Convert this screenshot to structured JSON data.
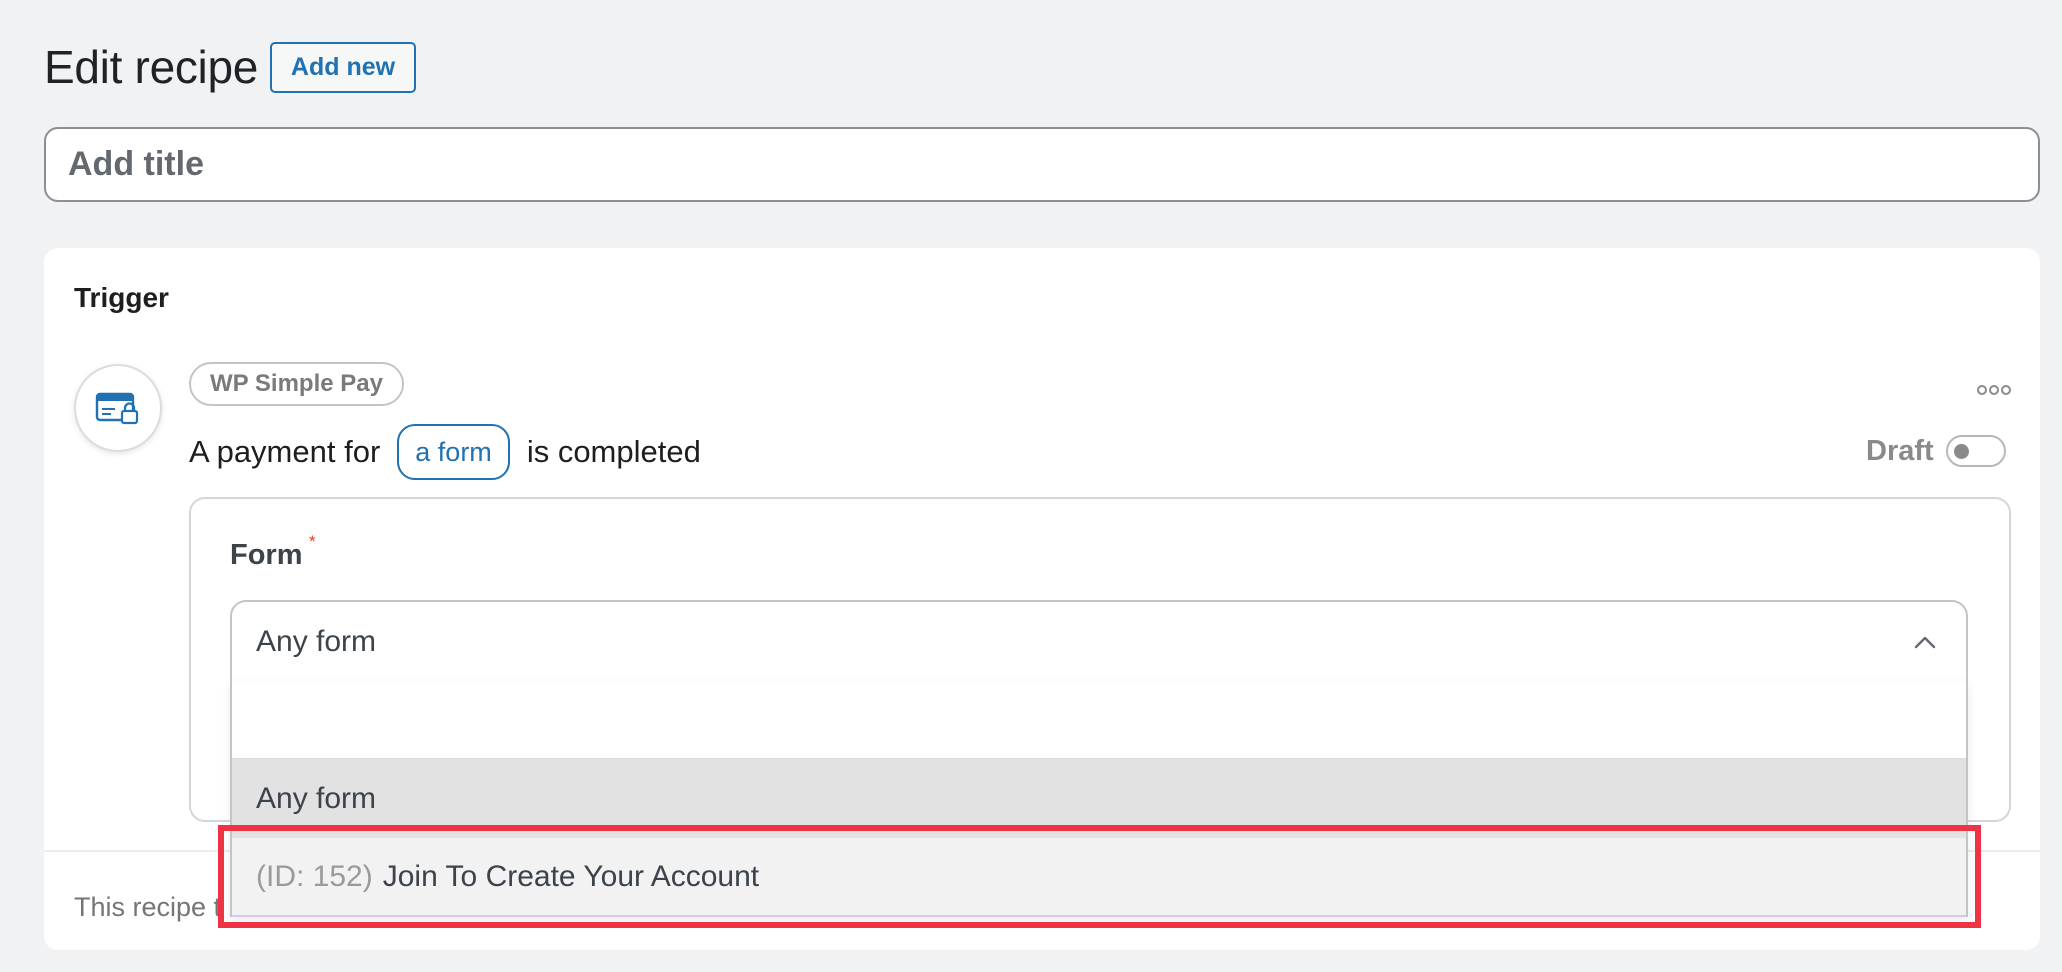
{
  "header": {
    "title": "Edit recipe",
    "add_new_label": "Add new"
  },
  "title_field": {
    "placeholder": "Add title",
    "value": ""
  },
  "trigger": {
    "heading": "Trigger",
    "integration_icon": "credit-card-lock-icon",
    "integration_name": "WP Simple Pay",
    "sentence_before": "A payment for",
    "sentence_token": "a form",
    "sentence_after": "is completed",
    "more_icon": "more-options-icon",
    "status_label": "Draft",
    "status_on": false,
    "footer_text": "This recipe t"
  },
  "form_field": {
    "label": "Form",
    "required_marker": "*",
    "selected_value": "Any form",
    "search_value": "",
    "options": [
      {
        "id": "",
        "label": "Any form",
        "highlighted": true
      },
      {
        "id": "(ID: 152)",
        "label": "Join To Create Your Account",
        "highlighted": false
      }
    ]
  },
  "colors": {
    "accent": "#2271b1",
    "page_bg": "#f1f2f4",
    "highlight_annotation": "#ee3344",
    "required": "#e2401c"
  }
}
